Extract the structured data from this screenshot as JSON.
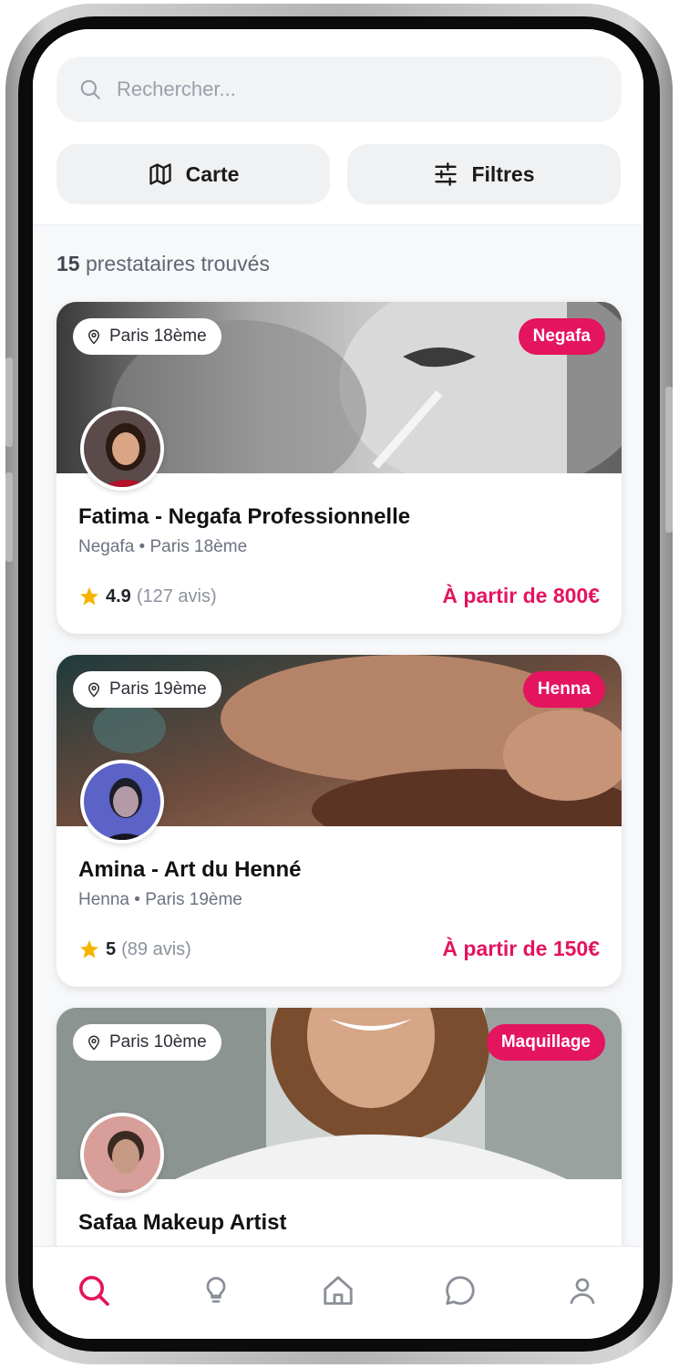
{
  "search": {
    "placeholder": "Rechercher..."
  },
  "actions": {
    "map_label": "Carte",
    "filters_label": "Filtres"
  },
  "results": {
    "count": "15",
    "label": "prestataires trouvés"
  },
  "providers": [
    {
      "location": "Paris 18ème",
      "category": "Negafa",
      "name": "Fatima - Negafa Professionnelle",
      "subtitle": "Negafa • Paris 18ème",
      "rating": "4.9",
      "reviews": "(127 avis)",
      "price": "À partir de 800€"
    },
    {
      "location": "Paris 19ème",
      "category": "Henna",
      "name": "Amina - Art du Henné",
      "subtitle": "Henna • Paris 19ème",
      "rating": "5",
      "reviews": "(89 avis)",
      "price": "À partir de 150€"
    },
    {
      "location": "Paris 10ème",
      "category": "Maquillage",
      "name": "Safaa Makeup Artist"
    }
  ],
  "nav": {
    "items": [
      "search-icon",
      "lightbulb-icon",
      "home-icon",
      "chat-icon",
      "profile-icon"
    ],
    "active": "search-icon"
  },
  "colors": {
    "accent": "#e4145f",
    "star": "#f5b400",
    "background": "#f7f8fa"
  }
}
